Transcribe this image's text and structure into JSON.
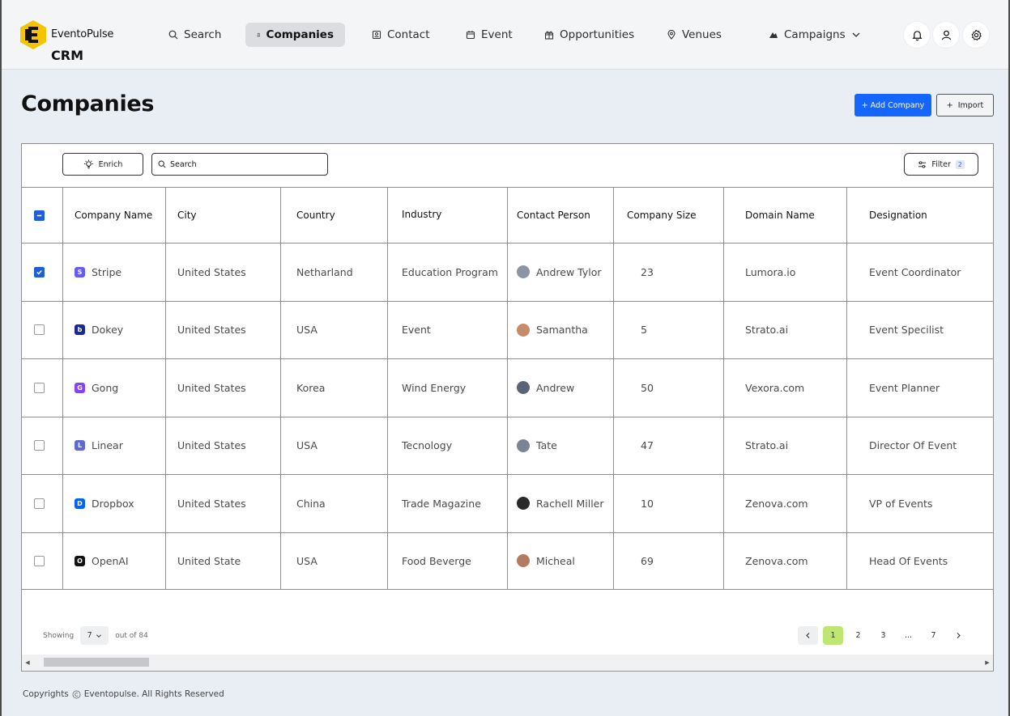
{
  "brand": {
    "name": "EventoPulse",
    "sub": "CRM"
  },
  "nav": {
    "search": "Search",
    "companies": "Companies",
    "contact": "Contact",
    "event": "Event",
    "opportunities": "Opportunities",
    "venues": "Venues",
    "campaigns": "Campaigns"
  },
  "page": {
    "title": "Companies",
    "add_label": "+ Add Company",
    "import_label": "Import"
  },
  "toolbar": {
    "enrich_label": "Enrich",
    "search_placeholder": "Search",
    "filter_label": "Filter",
    "filter_count": "2"
  },
  "table": {
    "headers": [
      "Company Name",
      "City",
      "Country",
      "Industry",
      "Contact Person",
      "Company Size",
      "Domain Name",
      "Designation"
    ],
    "rows": [
      {
        "checked": true,
        "company": "Stripe",
        "logo_color": "#635bff",
        "logo_glyph": "S",
        "city": "United States",
        "country": "Netharland",
        "industry": "Education Program",
        "contact": "Andrew Tylor",
        "avatar_color": "#8b95a6",
        "size": "23",
        "domain": "Lumora.io",
        "designation": "Event Coordinator"
      },
      {
        "checked": false,
        "company": "Dokey",
        "logo_color": "#1b2a8f",
        "logo_glyph": "b",
        "city": "United States",
        "country": "USA",
        "industry": "Event",
        "contact": "Samantha",
        "avatar_color": "#c58b6b",
        "size": "5",
        "domain": "Strato.ai",
        "designation": "Event Specilist"
      },
      {
        "checked": false,
        "company": "Gong",
        "logo_color": "#8a3ffc",
        "logo_glyph": "G",
        "city": "United States",
        "country": "Korea",
        "industry": "Wind Energy",
        "contact": "Andrew",
        "avatar_color": "#5a6478",
        "size": "50",
        "domain": "Vexora.com",
        "designation": "Event Planner"
      },
      {
        "checked": false,
        "company": "Linear",
        "logo_color": "#5e6ad2",
        "logo_glyph": "L",
        "city": "United States",
        "country": "USA",
        "industry": "Tecnology",
        "contact": "Tate",
        "avatar_color": "#7a8494",
        "size": "47",
        "domain": "Strato.ai",
        "designation": "Director Of Event"
      },
      {
        "checked": false,
        "company": "Dropbox",
        "logo_color": "#0061ff",
        "logo_glyph": "D",
        "city": "United States",
        "country": "China",
        "industry": "Trade Magazine",
        "contact": "Rachell Miller",
        "avatar_color": "#2a2a2a",
        "size": "10",
        "domain": "Zenova.com",
        "designation": "VP of Events"
      },
      {
        "checked": false,
        "company": "OpenAI",
        "logo_color": "#111111",
        "logo_glyph": "O",
        "city": "United State",
        "country": "USA",
        "industry": "Food Beverge",
        "contact": "Micheal",
        "avatar_color": "#b57a62",
        "size": "69",
        "domain": "Zenova.com",
        "designation": "Head Of Events"
      }
    ]
  },
  "pagination": {
    "showing_label": "Showing",
    "page_size": "7",
    "out_of": "out of 84",
    "pages": [
      "1",
      "2",
      "3",
      "...",
      "7"
    ],
    "current": "1"
  },
  "footer": {
    "prefix": "Copyrights",
    "text": "Eventopulse. All Rights Reserved"
  },
  "colors": {
    "accent": "#1565ff",
    "active_page": "#bfe673",
    "checkbox": "#1f5ed8",
    "brand_yellow": "#f5c400"
  }
}
